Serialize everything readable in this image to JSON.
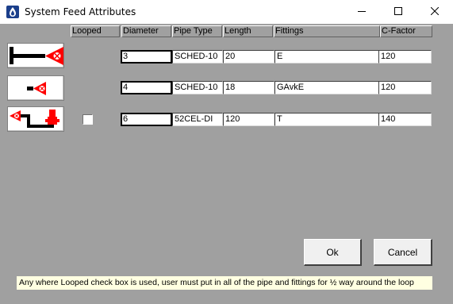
{
  "window": {
    "title": "System Feed Attributes",
    "icon": "app-logo-icon",
    "controls": [
      "minimize-icon",
      "maximize-icon",
      "close-icon"
    ]
  },
  "columns": {
    "looped": "Looped",
    "diameter": "Diameter",
    "pipe_type": "Pipe Type",
    "length": "Length",
    "fittings": "Fittings",
    "c_factor": "C-Factor"
  },
  "rows": [
    {
      "picture": "tee-feed-icon",
      "looped_shown": false,
      "diameter": "3",
      "pipe_type": "SCHED-10",
      "length": "20",
      "fittings": "E",
      "c_factor": "120"
    },
    {
      "picture": "valve-feed-icon",
      "looped_shown": false,
      "diameter": "4",
      "pipe_type": "SCHED-10",
      "length": "18",
      "fittings": "GAvkE",
      "c_factor": "120"
    },
    {
      "picture": "hydrant-feed-icon",
      "looped_shown": true,
      "looped_checked": false,
      "diameter": "6",
      "pipe_type": "52CEL-DI",
      "length": "120",
      "fittings": "T",
      "c_factor": "140"
    }
  ],
  "buttons": {
    "ok": "Ok",
    "cancel": "Cancel"
  },
  "note": "Any where Looped check box is used, user must put in all of the pipe and fittings for ½ way around the loop",
  "colors": {
    "dialog_bg": "#a0a0a0",
    "note_bg": "#ffffe1",
    "symbol_red": "#ff0000"
  }
}
